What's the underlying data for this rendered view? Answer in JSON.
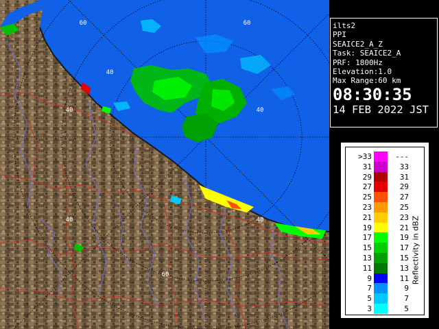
{
  "info": {
    "site": "ilts2",
    "product": "PPI",
    "field": "SEAICE2_A_Z",
    "task": "Task: SEAICE2_A",
    "prf": "PRF: 1800Hz",
    "elevation": "Elevation:1.0",
    "max_range": "Max Range:60 km",
    "time": "08:30:35",
    "date": "14 FEB 2022 JST"
  },
  "range_labels": [
    "60",
    "60",
    "40",
    "40",
    "40",
    "40",
    "40",
    "60"
  ],
  "legend": {
    "unit": "Reflectivity in dBZ",
    "rows": [
      {
        "low": ">33",
        "high": "---",
        "color": "#ff00ff"
      },
      {
        "low": "31",
        "high": "33",
        "color": "#cc00cc"
      },
      {
        "low": "29",
        "high": "31",
        "color": "#b20000"
      },
      {
        "low": "27",
        "high": "29",
        "color": "#e60000"
      },
      {
        "low": "25",
        "high": "27",
        "color": "#ff5000"
      },
      {
        "low": "23",
        "high": "25",
        "color": "#ff9900"
      },
      {
        "low": "21",
        "high": "23",
        "color": "#ffcc00"
      },
      {
        "low": "19",
        "high": "21",
        "color": "#ffff00"
      },
      {
        "low": "17",
        "high": "19",
        "color": "#00ff00"
      },
      {
        "low": "15",
        "high": "17",
        "color": "#00cc00"
      },
      {
        "low": "13",
        "high": "15",
        "color": "#00a000"
      },
      {
        "low": "11",
        "high": "13",
        "color": "#007800"
      },
      {
        "low": "9",
        "high": "11",
        "color": "#0000ff"
      },
      {
        "low": "7",
        "high": "9",
        "color": "#0090ff"
      },
      {
        "low": "5",
        "high": "7",
        "color": "#00c8ff"
      },
      {
        "low": "3",
        "high": "5",
        "color": "#00ffff"
      }
    ]
  },
  "colors": {
    "sea": "#1160e8",
    "land": "#7a6448",
    "river": "#6c70d8",
    "boundary": "#c4342a",
    "ring": "#000000"
  }
}
